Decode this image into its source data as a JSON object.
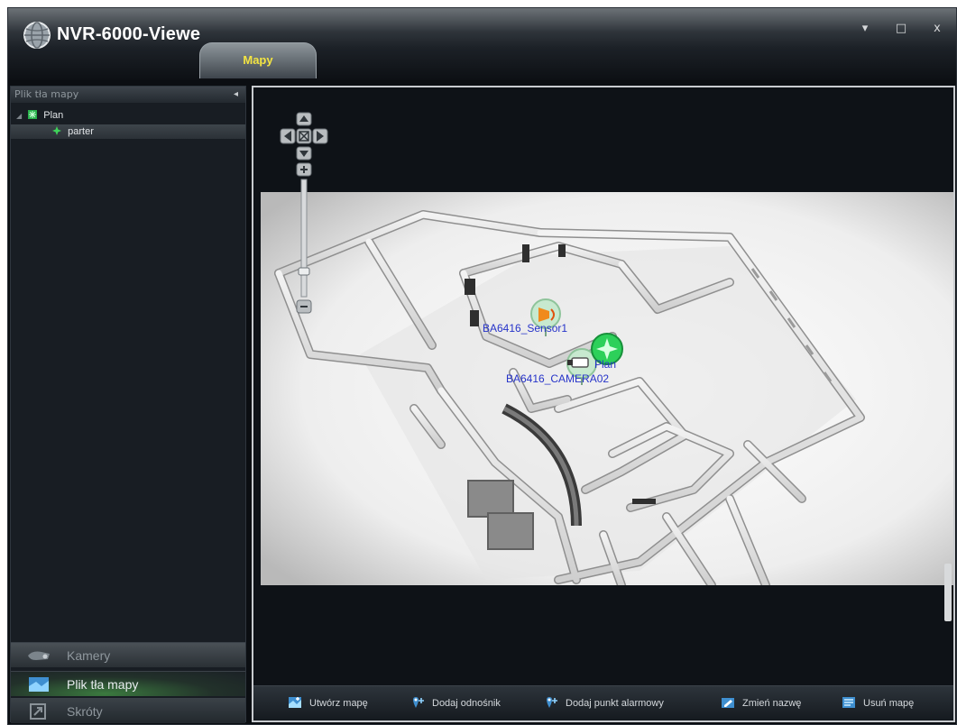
{
  "window": {
    "title": "NVR-6000-Viewe",
    "controls": {
      "menu": "▾",
      "maximize": "□",
      "close": "x"
    }
  },
  "tabs": [
    {
      "label": "Mapy",
      "active": true
    }
  ],
  "sidebar": {
    "header": "Plik tła mapy",
    "collapse_icon": "◂",
    "tree": [
      {
        "label": "Plan",
        "level": 0,
        "icon": "map-node-icon"
      },
      {
        "label": "parter",
        "level": 1,
        "icon": "map-node-icon",
        "selected": true
      }
    ],
    "nav": [
      {
        "label": "Kamery",
        "icon": "camera-icon"
      },
      {
        "label": "Plik tła mapy",
        "icon": "map-file-icon",
        "active": true
      },
      {
        "label": "Skróty",
        "icon": "shortcut-icon"
      }
    ]
  },
  "map": {
    "markers": [
      {
        "label": "BA6416_Sensor1",
        "icon": "alarm-sensor-icon"
      },
      {
        "label": "BA6416_CAMERA02",
        "icon": "camera-marker-icon"
      },
      {
        "label": "Plan",
        "icon": "map-link-icon"
      }
    ],
    "controls": {
      "up": "▲",
      "down": "▼",
      "left": "◀",
      "right": "▶",
      "center": "⊠",
      "zoom_in": "+",
      "zoom_out": "−"
    }
  },
  "toolbar": {
    "buttons": [
      {
        "label": "Utwórz mapę",
        "icon": "create-map-icon"
      },
      {
        "label": "Dodaj odnośnik",
        "icon": "add-link-icon"
      },
      {
        "label": "Dodaj punkt alarmowy",
        "icon": "add-alarm-point-icon"
      },
      {
        "label": "Zmień nazwę",
        "icon": "rename-icon"
      },
      {
        "label": "Usuń mapę",
        "icon": "delete-map-icon"
      }
    ]
  },
  "colors": {
    "tab_text": "#f4e542",
    "marker_label": "#2633c9",
    "marker_green": "#2dd05a",
    "marker_orange": "#f08a1c"
  }
}
